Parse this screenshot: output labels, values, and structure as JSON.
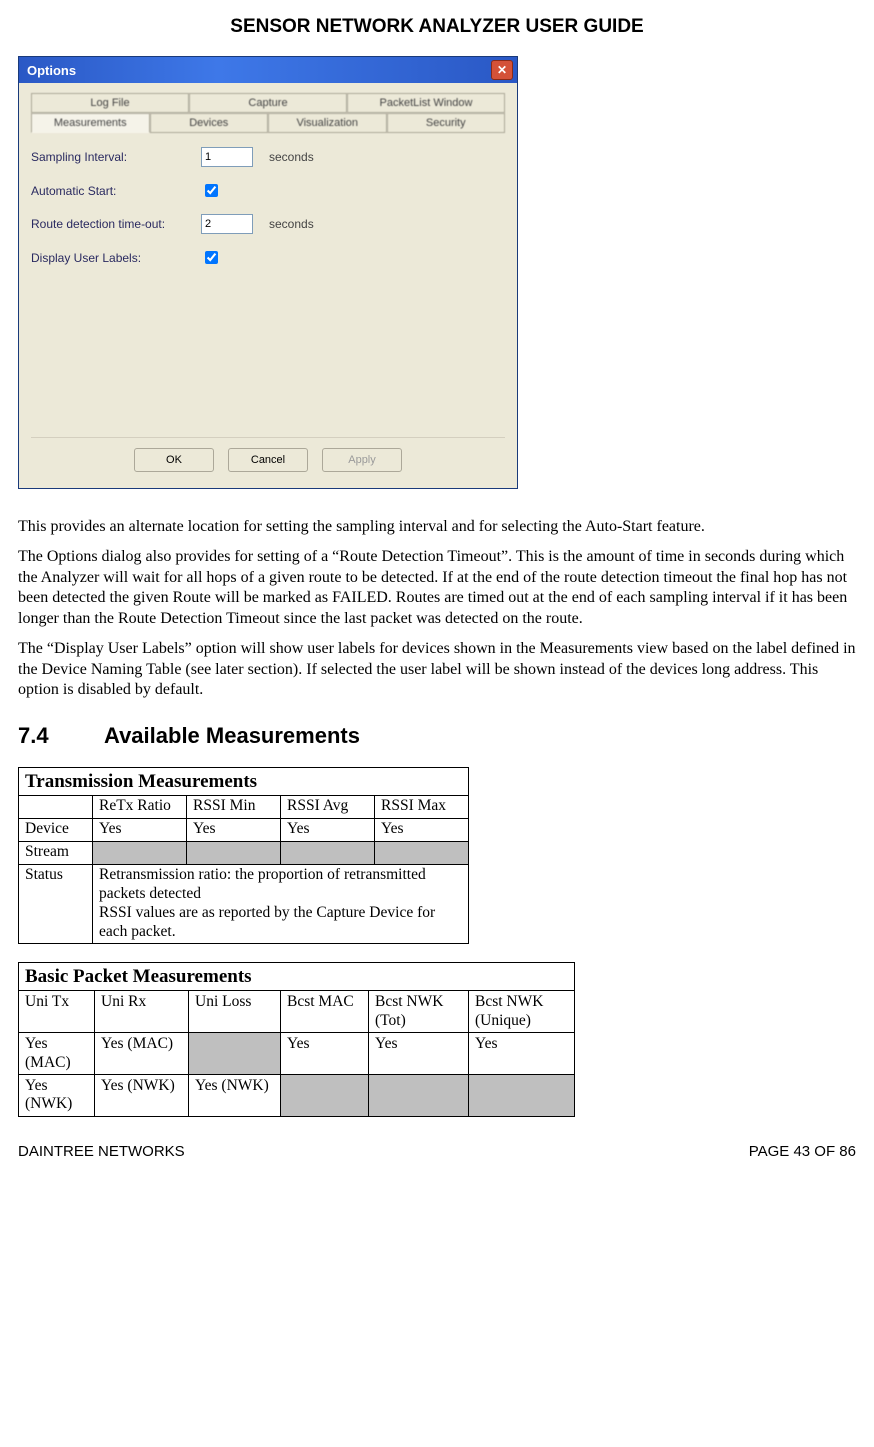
{
  "header": {
    "title": "SENSOR NETWORK ANALYZER USER GUIDE"
  },
  "dialog": {
    "title": "Options",
    "tabs_row1": [
      "Log File",
      "Capture",
      "PacketList Window"
    ],
    "tabs_row2": [
      "Measurements",
      "Devices",
      "Visualization",
      "Security"
    ],
    "fields": {
      "sampling_label": "Sampling Interval:",
      "sampling_value": "1",
      "sampling_unit": "seconds",
      "autostart_label": "Automatic Start:",
      "route_label": "Route detection time-out:",
      "route_value": "2",
      "route_unit": "seconds",
      "display_labels_label": "Display User Labels:"
    },
    "buttons": {
      "ok": "OK",
      "cancel": "Cancel",
      "apply": "Apply"
    }
  },
  "paragraphs": {
    "p1": "This provides an alternate location for setting the sampling interval and for selecting the Auto-Start feature.",
    "p2": "The Options dialog also provides for setting of a “Route Detection Timeout”. This is the amount of time in seconds during which the Analyzer will wait for all hops of a given route to be detected. If at the end of the route detection timeout the final hop has not been detected the given Route will be marked as FAILED. Routes are timed out at the end of each sampling interval if it has been longer than the Route Detection Timeout since the last packet was detected on the route.",
    "p3": "The “Display User Labels” option will show user labels for devices shown in the Measurements view based on the label defined in the Device Naming Table (see later section). If selected the user label will be shown instead of the devices long address. This option is disabled by default."
  },
  "section": {
    "num": "7.4",
    "title": "Available Measurements"
  },
  "table1": {
    "title": "Transmission Measurements",
    "headers": [
      "",
      "ReTx Ratio",
      "RSSI Min",
      "RSSI Avg",
      "RSSI Max"
    ],
    "rows": [
      {
        "label": "Device",
        "c1": "Yes",
        "c2": "Yes",
        "c3": "Yes",
        "c4": "Yes"
      },
      {
        "label": "Stream",
        "grey": true
      },
      {
        "label": "Status",
        "span": "Retransmission ratio: the proportion of retransmitted packets detected\nRSSI values are as reported by the Capture Device for each packet."
      }
    ]
  },
  "table2": {
    "title": "Basic Packet Measurements",
    "headers": [
      "Uni Tx",
      "Uni Rx",
      "Uni Loss",
      "Bcst MAC",
      "Bcst NWK (Tot)",
      "Bcst NWK (Unique)"
    ],
    "rows": [
      {
        "c0": "Yes (MAC)",
        "c1": "Yes (MAC)",
        "c2grey": true,
        "c3": "Yes",
        "c4": "Yes",
        "c5": "Yes"
      },
      {
        "c0": "Yes (NWK)",
        "c1": "Yes (NWK)",
        "c2": "Yes (NWK)",
        "c3grey": true,
        "c4grey": true,
        "c5grey": true
      }
    ]
  },
  "footer": {
    "left": "DAINTREE NETWORKS",
    "right": "PAGE 43 OF 86"
  }
}
